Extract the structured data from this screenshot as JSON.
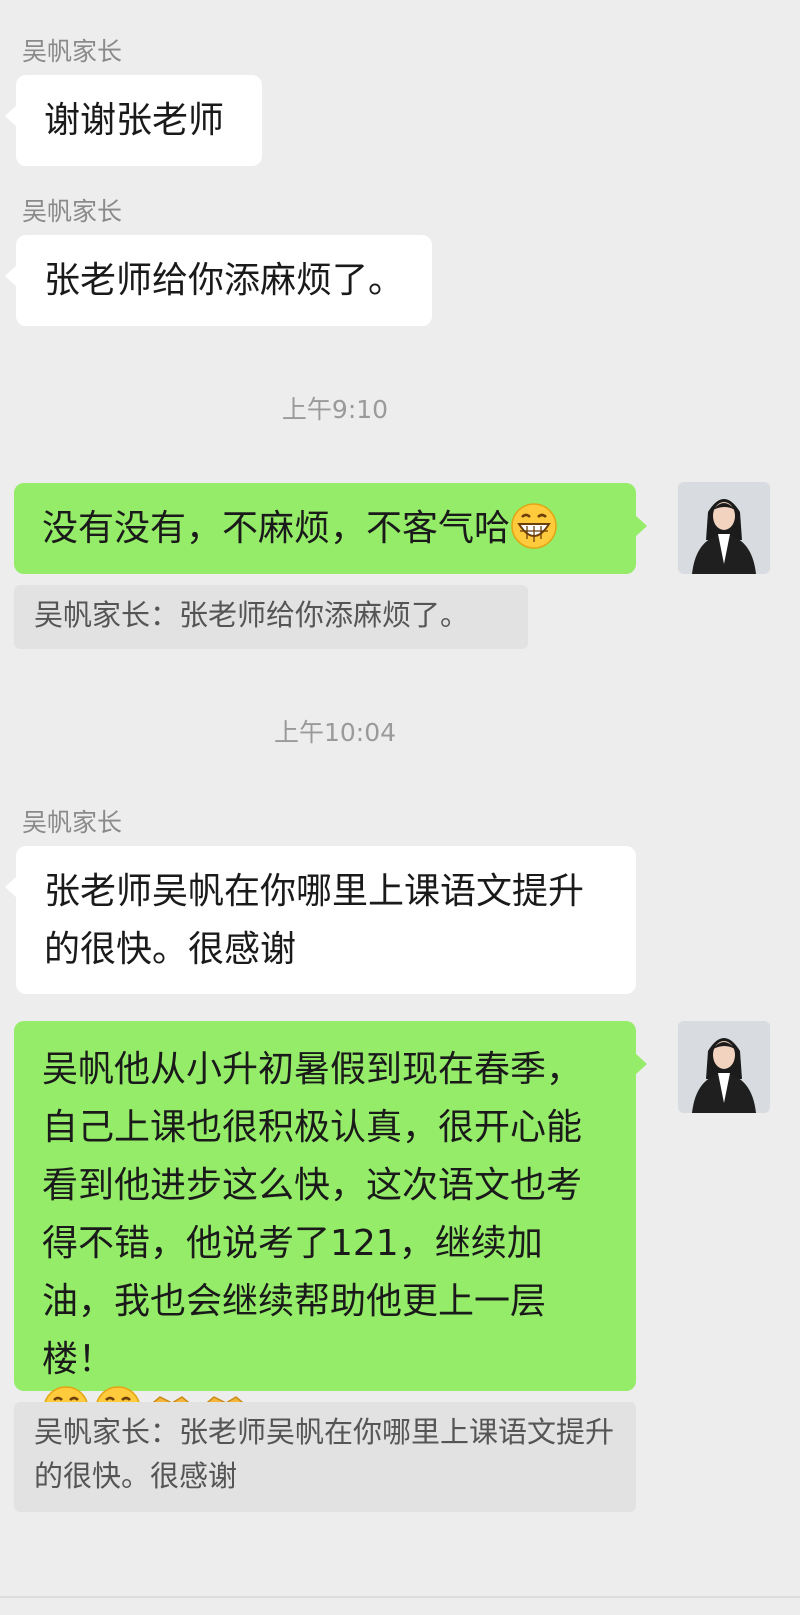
{
  "messages": [
    {
      "sender": "吴帆家长",
      "text": "谢谢张老师"
    },
    {
      "sender": "吴帆家长",
      "text": "张老师给你添麻烦了。"
    },
    {
      "time": "上午9:10"
    },
    {
      "text": "没有没有，不客气哈",
      "quote": "吴帆家长：张老师给你添麻烦了。"
    },
    {
      "time": "上午10:04"
    },
    {
      "sender": "吴帆家长",
      "text": "张老师吴帆在你哪里上课语文提升的很快。很感谢"
    },
    {
      "text": "吴帆他从小升初暑假到现在春季，自己上课也很积极认真，很开心能看到他进步这么快，这次语文也考得不错，他说考了121，继续加油，我也会继续帮助他更上一层楼！",
      "quote": "吴帆家长：张老师吴帆在你哪里上课语文提升的很快。很感谢"
    }
  ],
  "fixed_texts": {
    "reply_short": "没有没有，不麻烦，不客气哈"
  },
  "colors": {
    "background": "#ededed",
    "incoming_bubble": "#ffffff",
    "outgoing_bubble": "#95ec69",
    "quote_box": "#e2e2e2"
  },
  "icons": [
    "grin-emoji",
    "handshake-emoji",
    "teacher-avatar"
  ]
}
